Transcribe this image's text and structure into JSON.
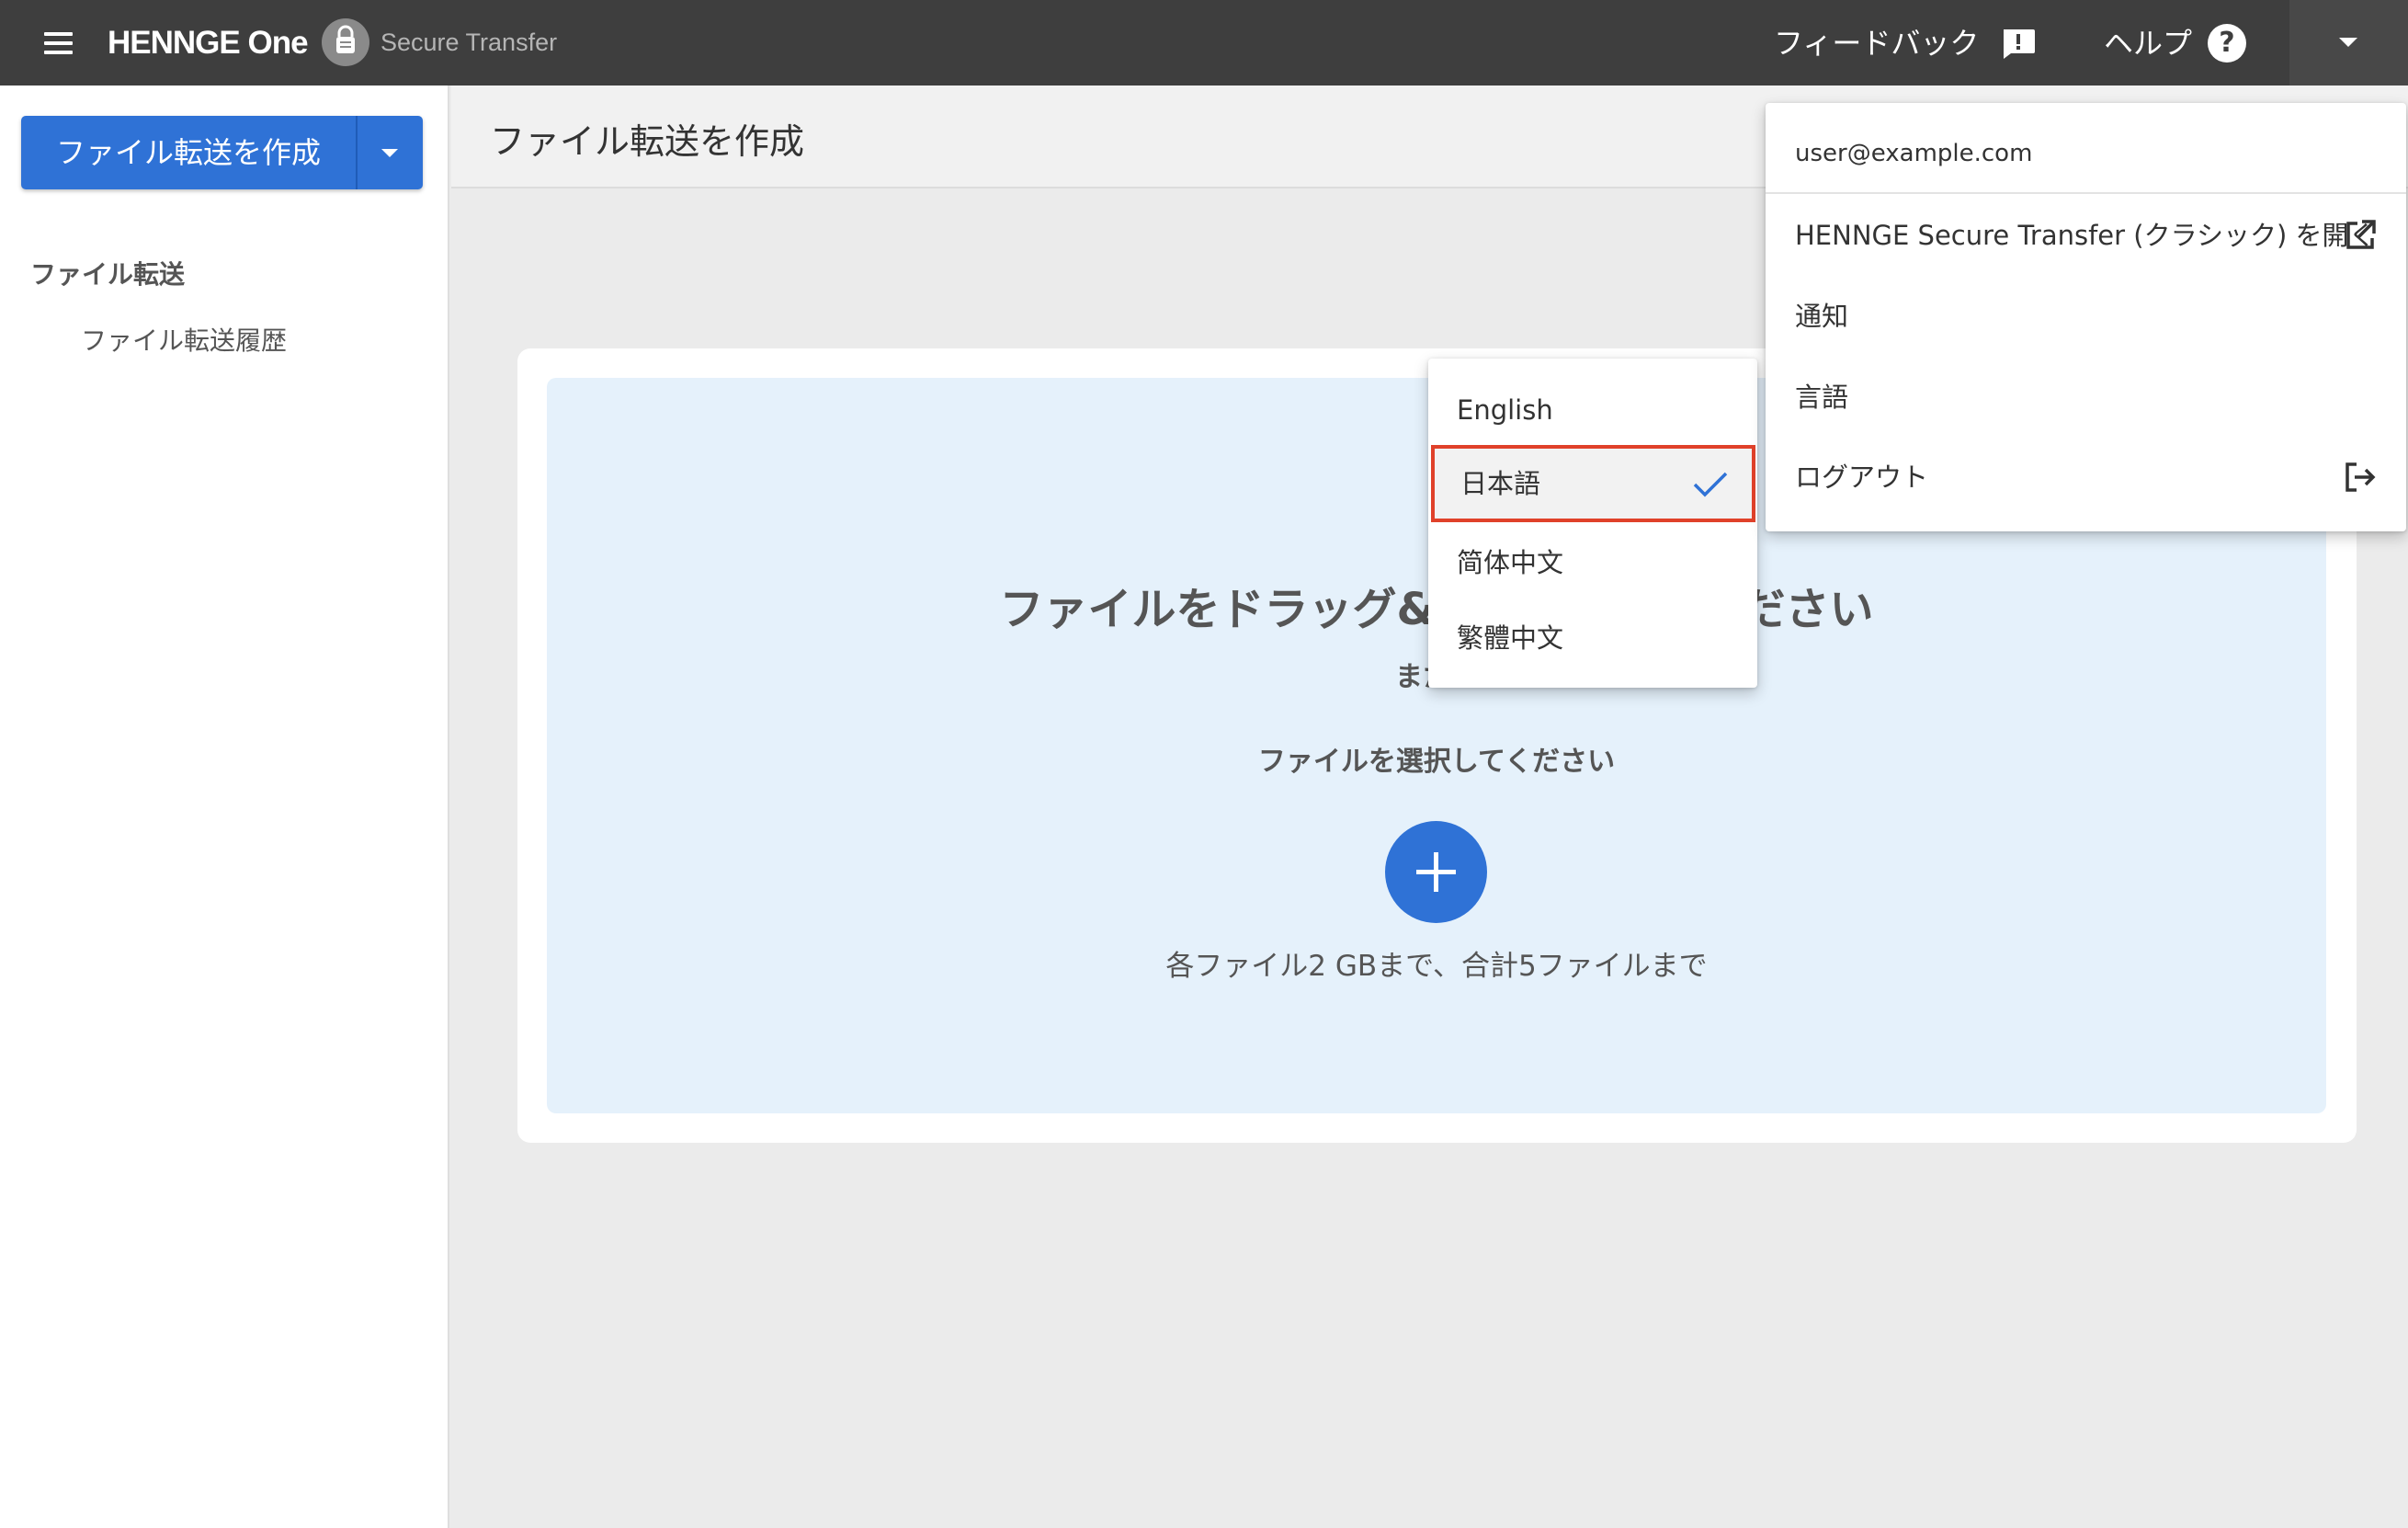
{
  "app": {
    "brand": "HENNGE One",
    "product": "Secure Transfer"
  },
  "topbar": {
    "feedback_label": "フィードバック",
    "help_label": "ヘルプ",
    "help_icon": "?"
  },
  "sidebar": {
    "create_button_label": "ファイル転送を作成",
    "section_heading": "ファイル転送",
    "items": [
      {
        "label": "ファイル転送履歴"
      }
    ]
  },
  "main": {
    "page_title": "ファイル転送を作成",
    "drop_title": "ファイルをドラッグ&ドロップしてください",
    "drop_or": "または",
    "drop_select": "ファイルを選択してください",
    "drop_limit": "各ファイル2 GBまで、合計5ファイルまで"
  },
  "language_menu": {
    "items": [
      {
        "label": "English",
        "selected": false
      },
      {
        "label": "日本語",
        "selected": true
      },
      {
        "label": "简体中文",
        "selected": false
      },
      {
        "label": "繁體中文",
        "selected": false
      }
    ]
  },
  "account_menu": {
    "email": "user@example.com",
    "items": [
      {
        "label": "HENNGE Secure Transfer (クラシック) を開く",
        "icon": "external-link-icon"
      },
      {
        "label": "通知"
      },
      {
        "label": "言語"
      },
      {
        "label": "ログアウト",
        "icon": "logout-icon"
      }
    ]
  },
  "colors": {
    "topbar": "#3e3e3e",
    "primary": "#2f72d6",
    "drop_zone": "#e5f1fb",
    "highlight_border": "#e0412a"
  }
}
